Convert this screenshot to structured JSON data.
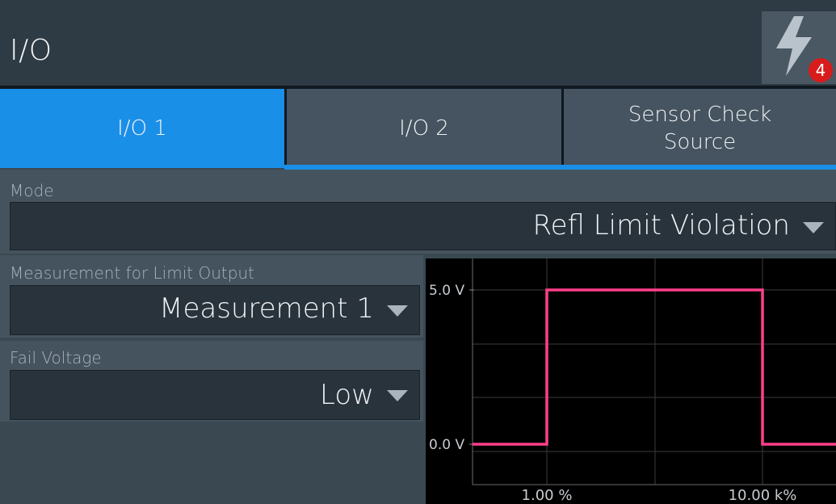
{
  "header": {
    "title": "I/O",
    "alert_count": "4"
  },
  "tabs": [
    {
      "label": "I/O 1",
      "active": true
    },
    {
      "label": "I/O 2",
      "active": false
    },
    {
      "label": "Sensor Check\nSource",
      "active": false
    }
  ],
  "mode": {
    "label": "Mode",
    "value": "Refl Limit Violation"
  },
  "measurement": {
    "label": "Measurement for Limit Output",
    "value": "Measurement 1"
  },
  "fail_voltage": {
    "label": "Fail Voltage",
    "value": "Low"
  },
  "chart_data": {
    "type": "line",
    "title": "",
    "y_tick_labels": [
      "5.0 V",
      "0.0 V"
    ],
    "x_tick_labels": [
      "1.00 %",
      "10.00 k%"
    ],
    "series": [
      {
        "color": "#ff3f8a",
        "points": [
          {
            "x": "start",
            "y": 0.0
          },
          {
            "x": "1.00 %",
            "y": 0.0
          },
          {
            "x": "1.00 %",
            "y": 5.0
          },
          {
            "x": "10.00 k%",
            "y": 5.0
          },
          {
            "x": "10.00 k%",
            "y": 0.0
          },
          {
            "x": "end",
            "y": 0.0
          }
        ]
      }
    ],
    "grid": true
  },
  "colors": {
    "accent": "#1a8fe8",
    "signal": "#ff3f8a",
    "badge": "#d81b1b"
  }
}
